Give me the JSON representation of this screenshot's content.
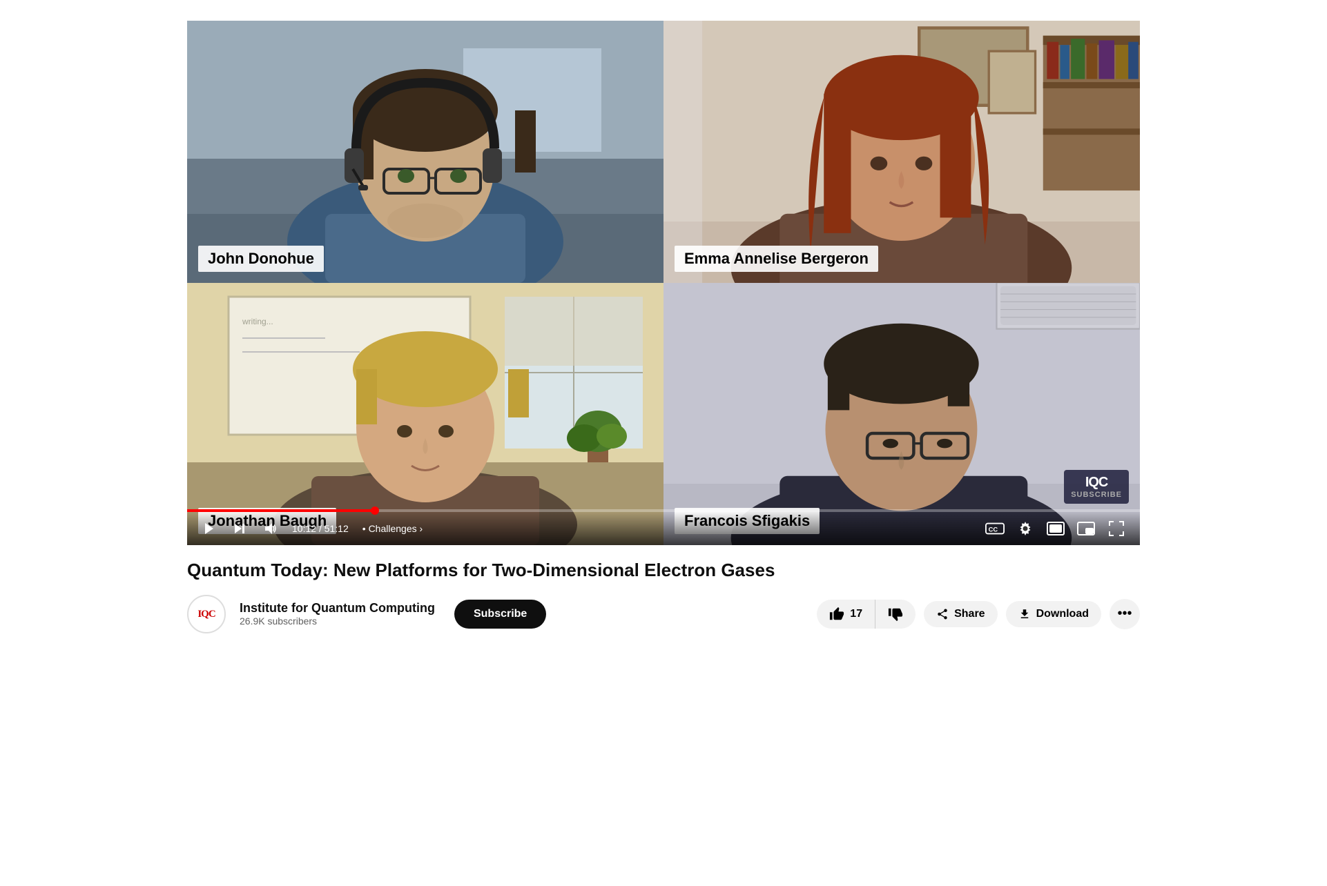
{
  "video": {
    "title": "Quantum Today: New Platforms for Two-Dimensional Electron Gases",
    "current_time": "10:12",
    "total_time": "51:12",
    "chapter": "Challenges",
    "progress_percent": 19.7,
    "participants": [
      {
        "name": "John Donohue",
        "position": "top-left",
        "bg_color1": "#b8bfc8",
        "bg_color2": "#8a95a0"
      },
      {
        "name": "Emma Annelise Bergeron",
        "position": "top-right",
        "bg_color1": "#d0c4b8",
        "bg_color2": "#a89888"
      },
      {
        "name": "Jonathan Baugh",
        "position": "bottom-left",
        "bg_color1": "#c8d0b8",
        "bg_color2": "#a0b090"
      },
      {
        "name": "Francois Sfigakis",
        "position": "bottom-right",
        "bg_color1": "#b8b8c4",
        "bg_color2": "#9090a0"
      }
    ],
    "watermark": {
      "line1": "IQC",
      "line2": "SUBSCRIBE"
    },
    "controls": {
      "play_pause": "▶",
      "next": "⏭",
      "volume": "🔊",
      "cc": "CC",
      "settings": "⚙",
      "theater": "⬜",
      "miniplayer": "⬛",
      "fullscreen": "⛶"
    }
  },
  "channel": {
    "logo_text": "IQC",
    "name": "Institute for Quantum Computing",
    "subscribers": "26.9K subscribers",
    "subscribe_label": "Subscribe"
  },
  "actions": {
    "like_count": "17",
    "like_label": "👍",
    "dislike_label": "👎",
    "share_label": "Share",
    "share_icon": "↗",
    "download_label": "Download",
    "download_icon": "⬇",
    "more_label": "..."
  }
}
